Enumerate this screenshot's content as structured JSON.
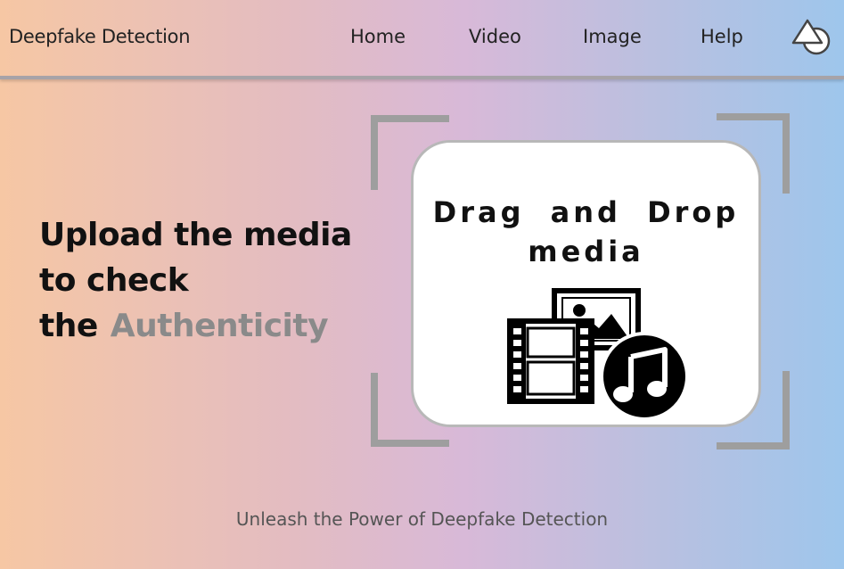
{
  "navbar": {
    "brand": "Deepfake Detection",
    "links": [
      {
        "label": "Home"
      },
      {
        "label": "Video"
      },
      {
        "label": "Image"
      },
      {
        "label": "Help"
      }
    ],
    "logo_icon": "shapes-logo-icon"
  },
  "hero": {
    "line1": "Upload the media",
    "line2": "to check",
    "line3_prefix": "the",
    "line3_accent": "Authenticity"
  },
  "dropzone": {
    "title_line1": "Drag and Drop",
    "title_line2": "media",
    "icon": "media-files-icon"
  },
  "footer": {
    "tagline": "Unleash the Power of Deepfake Detection"
  },
  "colors": {
    "gradient_left": "#f6c7a4",
    "gradient_mid": "#d8b9d8",
    "gradient_right": "#9ec6ec",
    "accent_text": "#8a8a8a",
    "bracket": "#9e9e9e"
  }
}
